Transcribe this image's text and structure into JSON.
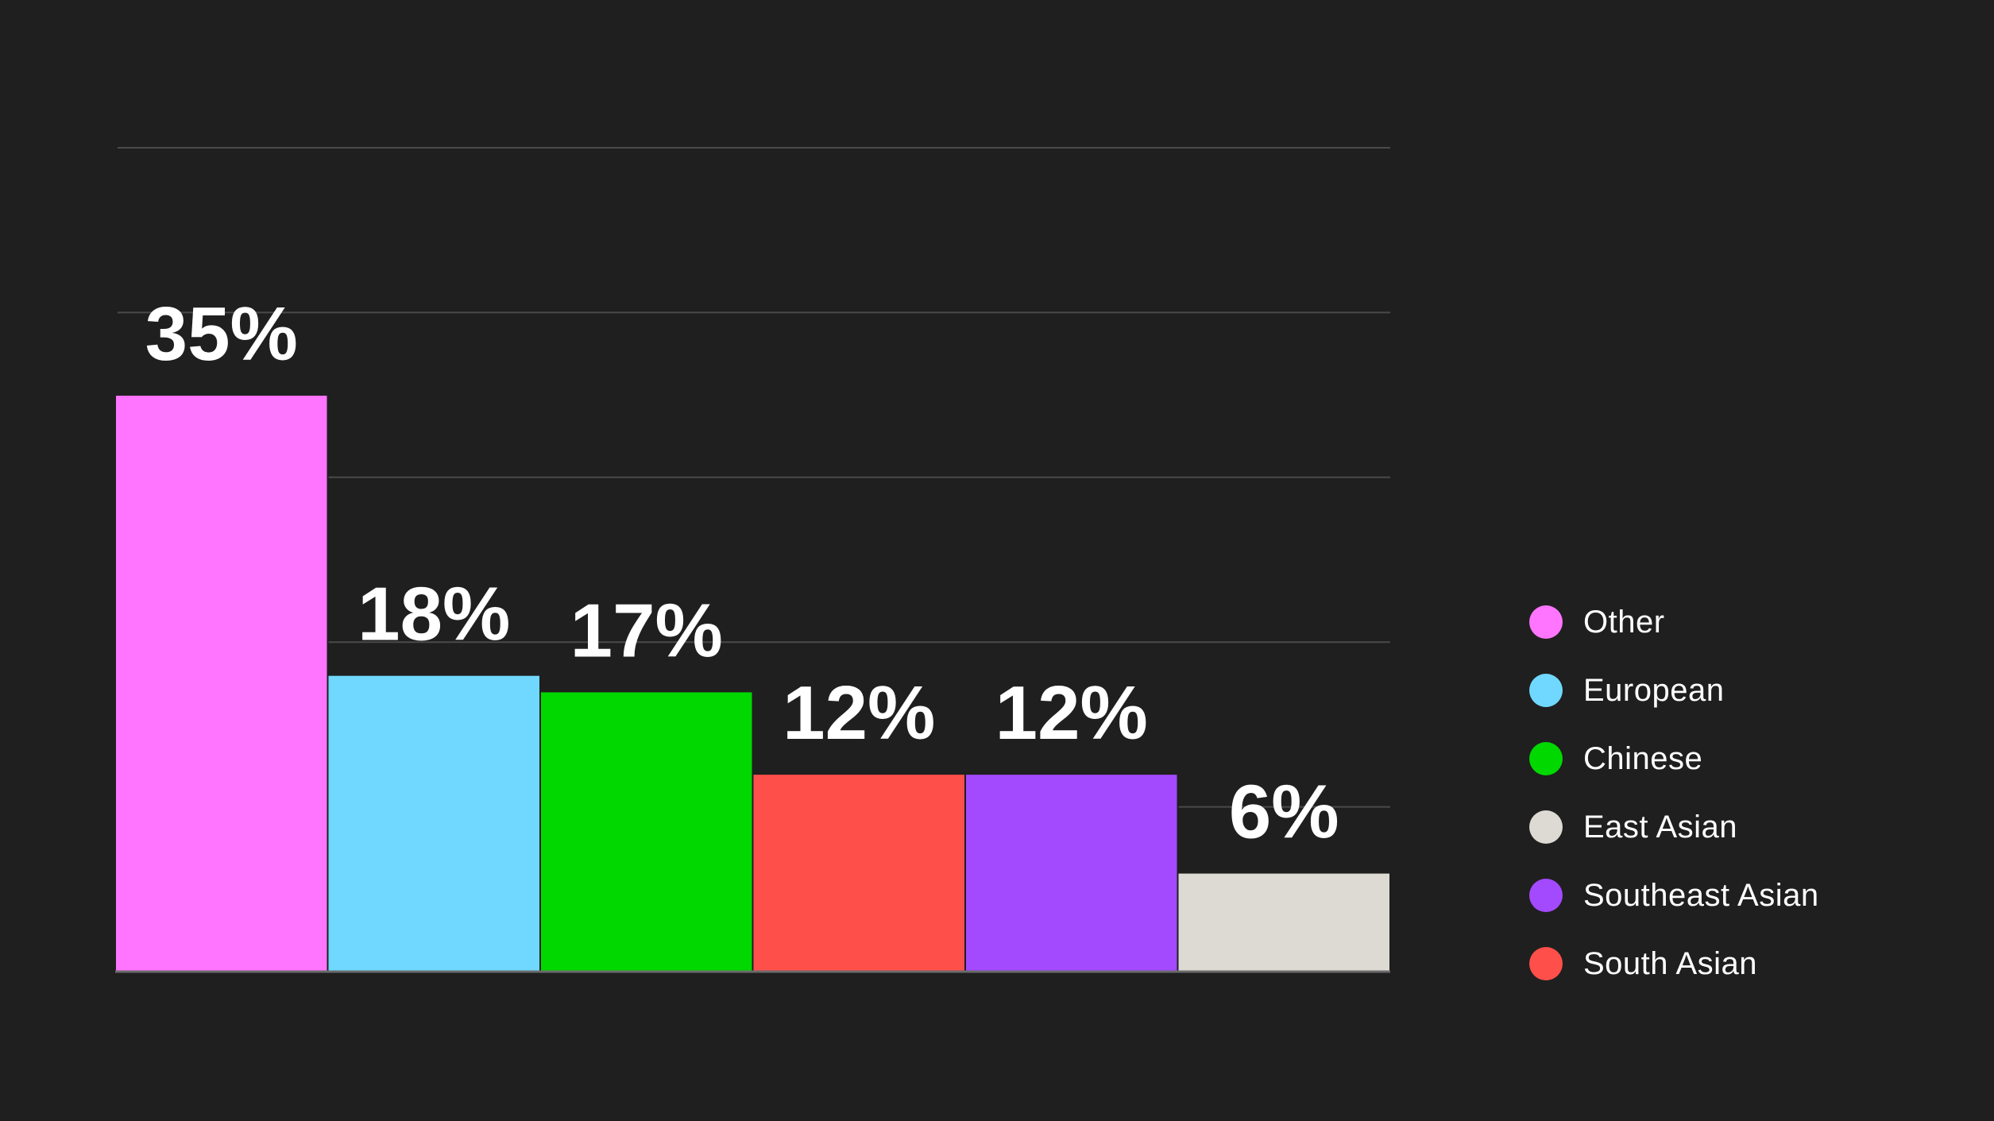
{
  "chart_data": {
    "type": "bar",
    "title": "",
    "xlabel": "",
    "ylabel": "",
    "categories": [
      "Other",
      "European",
      "Chinese",
      "South Asian",
      "Southeast Asian",
      "East Asian"
    ],
    "values": [
      35,
      18,
      17,
      12,
      12,
      6
    ],
    "value_labels": [
      "35%",
      "18%",
      "17%",
      "12%",
      "12%",
      "6%"
    ],
    "colors": [
      "#ff75ff",
      "#70d8ff",
      "#00d800",
      "#ff4f4a",
      "#a34aff",
      "#dddad3"
    ],
    "ylim": [
      0,
      50
    ],
    "yticks": [
      0,
      10,
      20,
      30,
      40,
      50
    ],
    "ytick_labels_visible": false,
    "grid": true,
    "legend_position": "right",
    "legend": [
      {
        "label": "Other",
        "color": "#ff75ff"
      },
      {
        "label": "European",
        "color": "#70d8ff"
      },
      {
        "label": "Chinese",
        "color": "#00d800"
      },
      {
        "label": "East Asian",
        "color": "#dddad3"
      },
      {
        "label": "Southeast Asian",
        "color": "#a34aff"
      },
      {
        "label": "South Asian",
        "color": "#ff4f4a"
      }
    ]
  },
  "background_color": "#1f1f1f"
}
